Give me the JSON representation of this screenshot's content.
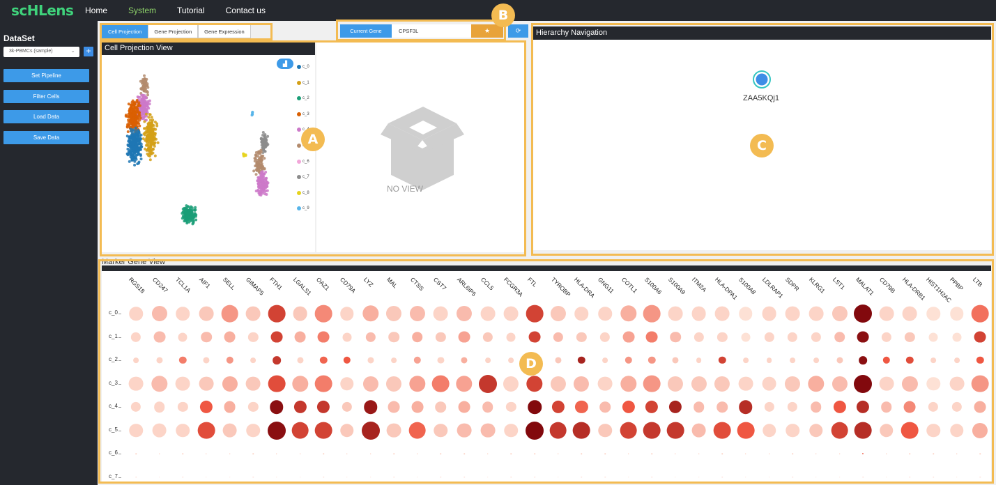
{
  "nav": {
    "logo": "scHLens",
    "items": [
      {
        "label": "Home",
        "active": false
      },
      {
        "label": "System",
        "active": true
      },
      {
        "label": "Tutorial",
        "active": false
      },
      {
        "label": "Contact us",
        "active": false
      }
    ]
  },
  "sidebar": {
    "title": "DataSet",
    "dataset_value": "3k-PBMCs (sample)",
    "add_label": "+",
    "buttons": [
      "Set Pipeline",
      "Filter Cells",
      "Load Data",
      "Save Data"
    ]
  },
  "projection": {
    "tabs": [
      {
        "label": "Cell Projection",
        "active": true
      },
      {
        "label": "Gene Projection",
        "active": false
      },
      {
        "label": "Gene Expression",
        "active": false
      }
    ],
    "title": "Cell Projection View",
    "legend": [
      "c_0",
      "c_1",
      "c_2",
      "c_3",
      "c_4",
      "c_5",
      "c_6",
      "c_7",
      "c_8",
      "c_9"
    ],
    "cluster_colors": [
      "#1f77b4",
      "#d4a017",
      "#1a9e77",
      "#d95f02",
      "#cc79c9",
      "#b38b6d",
      "#f2a6d9",
      "#8c8c8c",
      "#e6d31e",
      "#56b4e9"
    ],
    "no_view_label": "NO VIEW"
  },
  "gene_bar": {
    "label": "Current Gene",
    "value": "CPSF3L",
    "star": "★",
    "refresh": "⟳"
  },
  "hierarchy": {
    "title": "Hierarchy Navigation",
    "node_label": "ZAA5KQj1"
  },
  "marker": {
    "title": "Marker Gene View",
    "genes": [
      "RGS18",
      "CD247",
      "TCL1A",
      "AIF1",
      "SELL",
      "GIMAP5",
      "FTH1",
      "LGALS1",
      "OAZ1",
      "CD79A",
      "LYZ",
      "MAL",
      "CTSS",
      "CST7",
      "ARL6IP5",
      "CCL5",
      "FCGR3A",
      "FTL",
      "TYROBP",
      "HLA-DRA",
      "GNG11",
      "COTL1",
      "S100A6",
      "S100A9",
      "ITM2A",
      "HLA-DPA1",
      "S100A8",
      "LDLRAP1",
      "SDPR",
      "KLRG1",
      "LST1",
      "MALAT1",
      "CD79B",
      "HLA-DRB1",
      "HIST1H2AC",
      "PPBP",
      "LTB"
    ],
    "rows": [
      "c_0",
      "c_1",
      "c_2",
      "c_3",
      "c_4",
      "c_5",
      "c_6",
      "c_7"
    ],
    "size": [
      [
        0.75,
        0.85,
        0.75,
        0.8,
        0.95,
        0.8,
        0.95,
        0.8,
        0.95,
        0.75,
        0.9,
        0.85,
        0.85,
        0.8,
        0.85,
        0.8,
        0.8,
        0.95,
        0.85,
        0.75,
        0.75,
        0.9,
        0.95,
        0.8,
        0.8,
        0.8,
        0.75,
        0.8,
        0.8,
        0.8,
        0.85,
        1.0,
        0.8,
        0.8,
        0.75,
        0.75,
        0.95
      ],
      [
        0.55,
        0.65,
        0.5,
        0.6,
        0.65,
        0.55,
        0.65,
        0.65,
        0.65,
        0.5,
        0.55,
        0.6,
        0.6,
        0.55,
        0.65,
        0.55,
        0.5,
        0.65,
        0.55,
        0.55,
        0.55,
        0.65,
        0.65,
        0.6,
        0.55,
        0.55,
        0.5,
        0.55,
        0.55,
        0.55,
        0.6,
        0.65,
        0.55,
        0.55,
        0.5,
        0.5,
        0.65
      ],
      [
        0.3,
        0.35,
        0.4,
        0.35,
        0.4,
        0.3,
        0.45,
        0.35,
        0.4,
        0.4,
        0.35,
        0.3,
        0.4,
        0.35,
        0.35,
        0.3,
        0.3,
        0.4,
        0.35,
        0.4,
        0.3,
        0.4,
        0.4,
        0.35,
        0.3,
        0.4,
        0.3,
        0.3,
        0.3,
        0.3,
        0.35,
        0.45,
        0.4,
        0.4,
        0.3,
        0.3,
        0.4
      ],
      [
        0.8,
        0.9,
        0.8,
        0.8,
        0.85,
        0.8,
        0.95,
        0.9,
        0.95,
        0.75,
        0.85,
        0.85,
        0.9,
        0.95,
        0.9,
        1.0,
        0.85,
        0.9,
        0.85,
        0.85,
        0.8,
        0.9,
        0.95,
        0.85,
        0.85,
        0.85,
        0.8,
        0.8,
        0.85,
        0.9,
        0.85,
        1.0,
        0.8,
        0.85,
        0.75,
        0.8,
        0.95
      ],
      [
        0.55,
        0.6,
        0.55,
        0.7,
        0.65,
        0.55,
        0.75,
        0.7,
        0.7,
        0.55,
        0.75,
        0.65,
        0.65,
        0.6,
        0.65,
        0.6,
        0.55,
        0.75,
        0.7,
        0.7,
        0.6,
        0.7,
        0.7,
        0.7,
        0.6,
        0.6,
        0.75,
        0.55,
        0.55,
        0.6,
        0.7,
        0.7,
        0.6,
        0.65,
        0.55,
        0.55,
        0.65
      ],
      [
        0.75,
        0.8,
        0.75,
        0.95,
        0.8,
        0.75,
        1.0,
        0.95,
        0.95,
        0.75,
        1.0,
        0.8,
        0.95,
        0.75,
        0.8,
        0.8,
        0.75,
        1.0,
        0.95,
        0.95,
        0.75,
        0.95,
        0.95,
        0.95,
        0.8,
        0.95,
        0.95,
        0.75,
        0.75,
        0.75,
        0.95,
        0.95,
        0.75,
        0.95,
        0.75,
        0.75,
        0.85
      ],
      [
        0.05,
        0.05,
        0.05,
        0.05,
        0.05,
        0.05,
        0.05,
        0.05,
        0.05,
        0.05,
        0.05,
        0.05,
        0.05,
        0.05,
        0.05,
        0.05,
        0.05,
        0.05,
        0.05,
        0.05,
        0.05,
        0.05,
        0.05,
        0.05,
        0.05,
        0.05,
        0.05,
        0.05,
        0.05,
        0.05,
        0.05,
        0.08,
        0.05,
        0.05,
        0.05,
        0.05,
        0.05
      ],
      [
        0.02,
        0.02,
        0.02,
        0.02,
        0.02,
        0.02,
        0.02,
        0.02,
        0.02,
        0.02,
        0.02,
        0.02,
        0.02,
        0.02,
        0.02,
        0.02,
        0.02,
        0.02,
        0.02,
        0.02,
        0.02,
        0.02,
        0.02,
        0.02,
        0.02,
        0.02,
        0.02,
        0.02,
        0.02,
        0.02,
        0.02,
        0.02,
        0.02,
        0.02,
        0.02,
        0.02,
        0.02
      ]
    ],
    "intensity": [
      [
        0.1,
        0.2,
        0.1,
        0.15,
        0.35,
        0.15,
        0.7,
        0.15,
        0.4,
        0.1,
        0.25,
        0.15,
        0.2,
        0.1,
        0.2,
        0.1,
        0.1,
        0.7,
        0.15,
        0.1,
        0.1,
        0.25,
        0.35,
        0.1,
        0.1,
        0.1,
        0.05,
        0.1,
        0.1,
        0.1,
        0.15,
        0.98,
        0.1,
        0.1,
        0.05,
        0.05,
        0.5
      ],
      [
        0.1,
        0.2,
        0.1,
        0.2,
        0.25,
        0.1,
        0.7,
        0.25,
        0.45,
        0.1,
        0.2,
        0.15,
        0.25,
        0.15,
        0.3,
        0.15,
        0.1,
        0.7,
        0.2,
        0.15,
        0.1,
        0.3,
        0.45,
        0.2,
        0.1,
        0.1,
        0.05,
        0.1,
        0.1,
        0.1,
        0.2,
        0.95,
        0.1,
        0.15,
        0.05,
        0.05,
        0.7
      ],
      [
        0.1,
        0.1,
        0.45,
        0.1,
        0.35,
        0.1,
        0.75,
        0.1,
        0.55,
        0.6,
        0.1,
        0.1,
        0.3,
        0.1,
        0.25,
        0.1,
        0.1,
        0.5,
        0.15,
        0.85,
        0.1,
        0.35,
        0.35,
        0.15,
        0.1,
        0.7,
        0.1,
        0.1,
        0.1,
        0.1,
        0.15,
        0.95,
        0.6,
        0.65,
        0.1,
        0.1,
        0.6
      ],
      [
        0.1,
        0.2,
        0.1,
        0.15,
        0.25,
        0.15,
        0.65,
        0.25,
        0.45,
        0.1,
        0.2,
        0.15,
        0.3,
        0.45,
        0.3,
        0.75,
        0.1,
        0.7,
        0.15,
        0.2,
        0.1,
        0.25,
        0.35,
        0.15,
        0.15,
        0.15,
        0.1,
        0.1,
        0.15,
        0.25,
        0.2,
        0.98,
        0.1,
        0.2,
        0.05,
        0.1,
        0.35
      ],
      [
        0.1,
        0.1,
        0.1,
        0.6,
        0.25,
        0.1,
        0.95,
        0.75,
        0.75,
        0.15,
        0.9,
        0.2,
        0.25,
        0.15,
        0.25,
        0.2,
        0.1,
        0.98,
        0.7,
        0.55,
        0.2,
        0.6,
        0.7,
        0.85,
        0.2,
        0.2,
        0.8,
        0.1,
        0.1,
        0.2,
        0.6,
        0.8,
        0.2,
        0.4,
        0.1,
        0.1,
        0.25
      ],
      [
        0.1,
        0.1,
        0.1,
        0.65,
        0.15,
        0.1,
        0.95,
        0.7,
        0.7,
        0.15,
        0.85,
        0.15,
        0.55,
        0.15,
        0.2,
        0.2,
        0.1,
        0.98,
        0.75,
        0.8,
        0.15,
        0.7,
        0.75,
        0.75,
        0.2,
        0.65,
        0.6,
        0.1,
        0.1,
        0.15,
        0.7,
        0.8,
        0.15,
        0.6,
        0.1,
        0.1,
        0.25
      ],
      [
        0.1,
        0.1,
        0.1,
        0.1,
        0.1,
        0.1,
        0.1,
        0.1,
        0.1,
        0.1,
        0.1,
        0.1,
        0.1,
        0.1,
        0.1,
        0.1,
        0.1,
        0.1,
        0.1,
        0.1,
        0.1,
        0.1,
        0.1,
        0.1,
        0.1,
        0.1,
        0.1,
        0.1,
        0.1,
        0.1,
        0.1,
        0.5,
        0.1,
        0.1,
        0.1,
        0.1,
        0.1
      ],
      [
        0.1,
        0.1,
        0.1,
        0.1,
        0.1,
        0.1,
        0.1,
        0.1,
        0.1,
        0.1,
        0.1,
        0.1,
        0.1,
        0.1,
        0.1,
        0.1,
        0.1,
        0.1,
        0.1,
        0.1,
        0.1,
        0.1,
        0.1,
        0.1,
        0.1,
        0.1,
        0.1,
        0.1,
        0.1,
        0.1,
        0.1,
        0.1,
        0.1,
        0.1,
        0.1,
        0.1,
        0.1
      ]
    ]
  },
  "annotations": [
    "A",
    "B",
    "C",
    "D"
  ]
}
